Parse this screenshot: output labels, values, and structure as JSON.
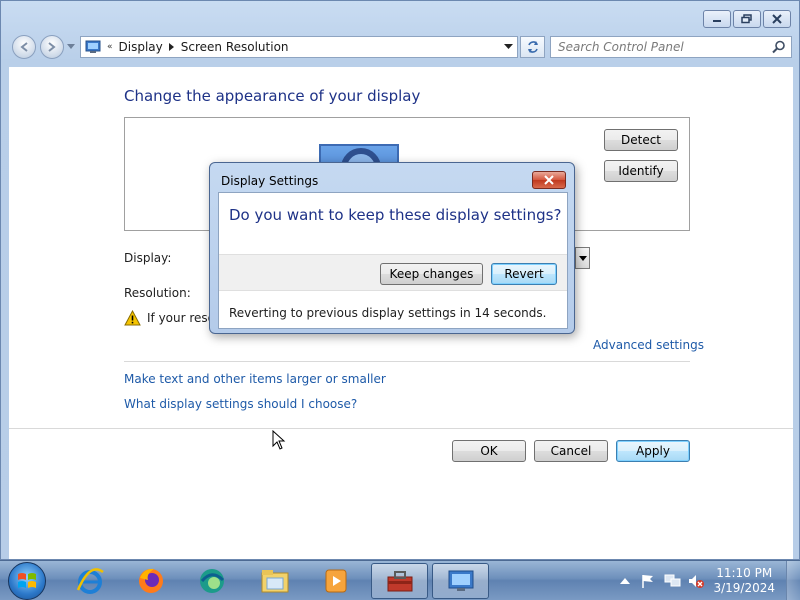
{
  "window": {
    "address_crumbs": [
      "Display",
      "Screen Resolution"
    ],
    "search_placeholder": "Search Control Panel"
  },
  "content": {
    "title": "Change the appearance of your display",
    "detect_button": "Detect",
    "identify_button": "Identify",
    "display_label": "Display:",
    "resolution_label": "Resolution:",
    "warning_text": "If your resolu",
    "advanced_link": "Advanced settings",
    "link_text_size": "Make text and other items larger or smaller",
    "link_help": "What display settings should I choose?",
    "ok_button": "OK",
    "cancel_button": "Cancel",
    "apply_button": "Apply"
  },
  "dialog": {
    "title": "Display Settings",
    "question": "Do you want to keep these display settings?",
    "keep_button": "Keep changes",
    "revert_button": "Revert",
    "message": "Reverting to previous display settings in 14 seconds."
  },
  "taskbar": {
    "pinned": [
      "internet-explorer-icon",
      "firefox-icon",
      "edge-icon",
      "file-explorer-icon",
      "media-player-icon",
      "toolbox-icon",
      "display-settings-icon"
    ],
    "time": "11:10 PM",
    "date": "3/19/2024"
  },
  "colors": {
    "title_blue": "#1e3287",
    "link_blue": "#1e5aa8",
    "close_red": "#c0391e"
  }
}
